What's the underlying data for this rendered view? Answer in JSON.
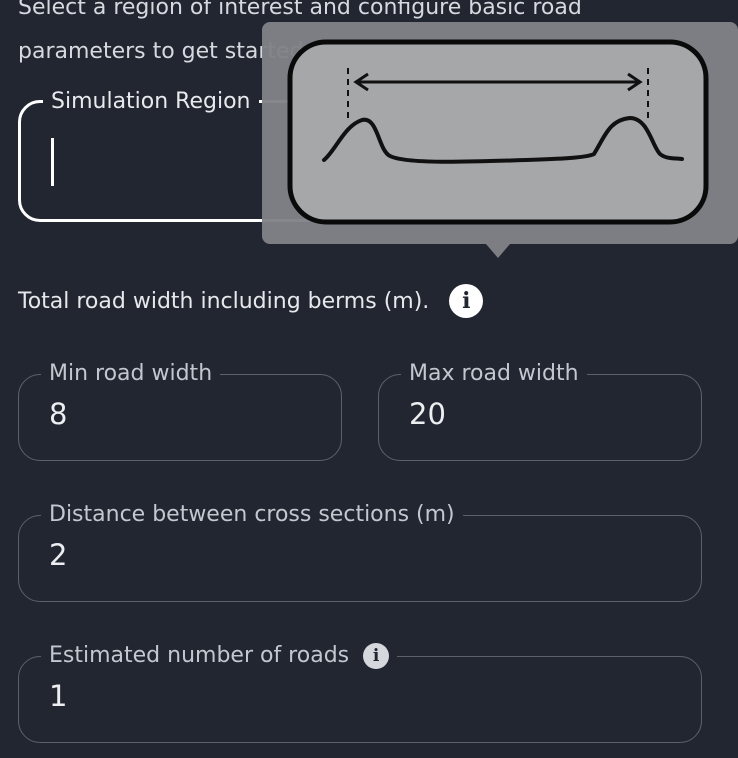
{
  "intro": {
    "line1": "Select a region of interest and configure basic road",
    "line2": "parameters to get started."
  },
  "simulation_region": {
    "label": "Simulation Region",
    "value": ""
  },
  "road_width_hint": {
    "text": "Total road width including berms (m).",
    "icon": "info-icon"
  },
  "min_road_width": {
    "label": "Min road width",
    "value": "8"
  },
  "max_road_width": {
    "label": "Max road width",
    "value": "20"
  },
  "cross_section_distance": {
    "label": "Distance between cross sections (m)",
    "value": "2"
  },
  "estimated_roads": {
    "label": "Estimated number of roads",
    "value": "1",
    "icon": "info-icon"
  },
  "tooltip": {
    "illustration": "road-cross-section-width-diagram"
  },
  "colors": {
    "background": "#222630",
    "border": "#5b616c",
    "active_border": "#ffffff",
    "tooltip": "#808286"
  }
}
